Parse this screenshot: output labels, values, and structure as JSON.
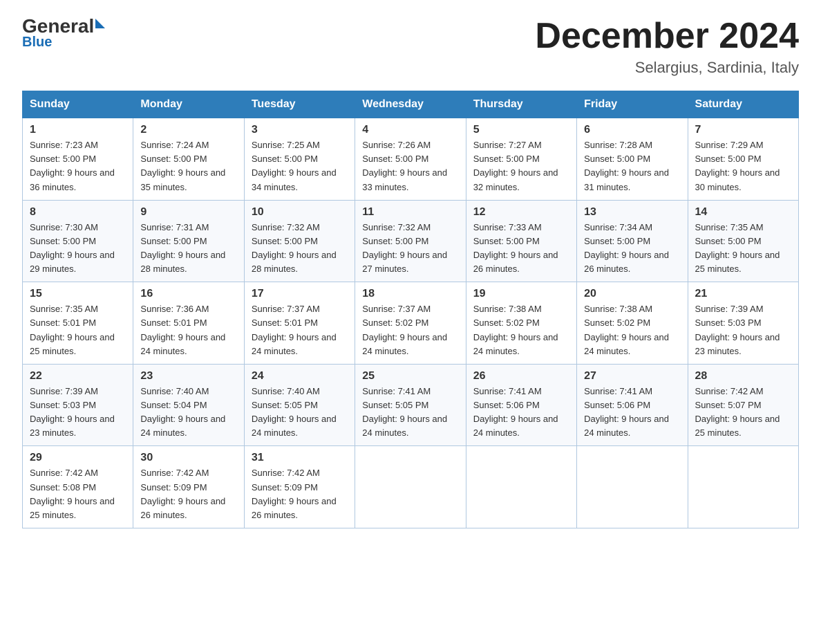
{
  "header": {
    "logo_general": "General",
    "logo_blue": "Blue",
    "title": "December 2024",
    "subtitle": "Selargius, Sardinia, Italy"
  },
  "columns": [
    "Sunday",
    "Monday",
    "Tuesday",
    "Wednesday",
    "Thursday",
    "Friday",
    "Saturday"
  ],
  "weeks": [
    [
      {
        "day": "1",
        "sunrise": "7:23 AM",
        "sunset": "5:00 PM",
        "daylight": "9 hours and 36 minutes."
      },
      {
        "day": "2",
        "sunrise": "7:24 AM",
        "sunset": "5:00 PM",
        "daylight": "9 hours and 35 minutes."
      },
      {
        "day": "3",
        "sunrise": "7:25 AM",
        "sunset": "5:00 PM",
        "daylight": "9 hours and 34 minutes."
      },
      {
        "day": "4",
        "sunrise": "7:26 AM",
        "sunset": "5:00 PM",
        "daylight": "9 hours and 33 minutes."
      },
      {
        "day": "5",
        "sunrise": "7:27 AM",
        "sunset": "5:00 PM",
        "daylight": "9 hours and 32 minutes."
      },
      {
        "day": "6",
        "sunrise": "7:28 AM",
        "sunset": "5:00 PM",
        "daylight": "9 hours and 31 minutes."
      },
      {
        "day": "7",
        "sunrise": "7:29 AM",
        "sunset": "5:00 PM",
        "daylight": "9 hours and 30 minutes."
      }
    ],
    [
      {
        "day": "8",
        "sunrise": "7:30 AM",
        "sunset": "5:00 PM",
        "daylight": "9 hours and 29 minutes."
      },
      {
        "day": "9",
        "sunrise": "7:31 AM",
        "sunset": "5:00 PM",
        "daylight": "9 hours and 28 minutes."
      },
      {
        "day": "10",
        "sunrise": "7:32 AM",
        "sunset": "5:00 PM",
        "daylight": "9 hours and 28 minutes."
      },
      {
        "day": "11",
        "sunrise": "7:32 AM",
        "sunset": "5:00 PM",
        "daylight": "9 hours and 27 minutes."
      },
      {
        "day": "12",
        "sunrise": "7:33 AM",
        "sunset": "5:00 PM",
        "daylight": "9 hours and 26 minutes."
      },
      {
        "day": "13",
        "sunrise": "7:34 AM",
        "sunset": "5:00 PM",
        "daylight": "9 hours and 26 minutes."
      },
      {
        "day": "14",
        "sunrise": "7:35 AM",
        "sunset": "5:00 PM",
        "daylight": "9 hours and 25 minutes."
      }
    ],
    [
      {
        "day": "15",
        "sunrise": "7:35 AM",
        "sunset": "5:01 PM",
        "daylight": "9 hours and 25 minutes."
      },
      {
        "day": "16",
        "sunrise": "7:36 AM",
        "sunset": "5:01 PM",
        "daylight": "9 hours and 24 minutes."
      },
      {
        "day": "17",
        "sunrise": "7:37 AM",
        "sunset": "5:01 PM",
        "daylight": "9 hours and 24 minutes."
      },
      {
        "day": "18",
        "sunrise": "7:37 AM",
        "sunset": "5:02 PM",
        "daylight": "9 hours and 24 minutes."
      },
      {
        "day": "19",
        "sunrise": "7:38 AM",
        "sunset": "5:02 PM",
        "daylight": "9 hours and 24 minutes."
      },
      {
        "day": "20",
        "sunrise": "7:38 AM",
        "sunset": "5:02 PM",
        "daylight": "9 hours and 24 minutes."
      },
      {
        "day": "21",
        "sunrise": "7:39 AM",
        "sunset": "5:03 PM",
        "daylight": "9 hours and 23 minutes."
      }
    ],
    [
      {
        "day": "22",
        "sunrise": "7:39 AM",
        "sunset": "5:03 PM",
        "daylight": "9 hours and 23 minutes."
      },
      {
        "day": "23",
        "sunrise": "7:40 AM",
        "sunset": "5:04 PM",
        "daylight": "9 hours and 24 minutes."
      },
      {
        "day": "24",
        "sunrise": "7:40 AM",
        "sunset": "5:05 PM",
        "daylight": "9 hours and 24 minutes."
      },
      {
        "day": "25",
        "sunrise": "7:41 AM",
        "sunset": "5:05 PM",
        "daylight": "9 hours and 24 minutes."
      },
      {
        "day": "26",
        "sunrise": "7:41 AM",
        "sunset": "5:06 PM",
        "daylight": "9 hours and 24 minutes."
      },
      {
        "day": "27",
        "sunrise": "7:41 AM",
        "sunset": "5:06 PM",
        "daylight": "9 hours and 24 minutes."
      },
      {
        "day": "28",
        "sunrise": "7:42 AM",
        "sunset": "5:07 PM",
        "daylight": "9 hours and 25 minutes."
      }
    ],
    [
      {
        "day": "29",
        "sunrise": "7:42 AM",
        "sunset": "5:08 PM",
        "daylight": "9 hours and 25 minutes."
      },
      {
        "day": "30",
        "sunrise": "7:42 AM",
        "sunset": "5:09 PM",
        "daylight": "9 hours and 26 minutes."
      },
      {
        "day": "31",
        "sunrise": "7:42 AM",
        "sunset": "5:09 PM",
        "daylight": "9 hours and 26 minutes."
      },
      null,
      null,
      null,
      null
    ]
  ]
}
